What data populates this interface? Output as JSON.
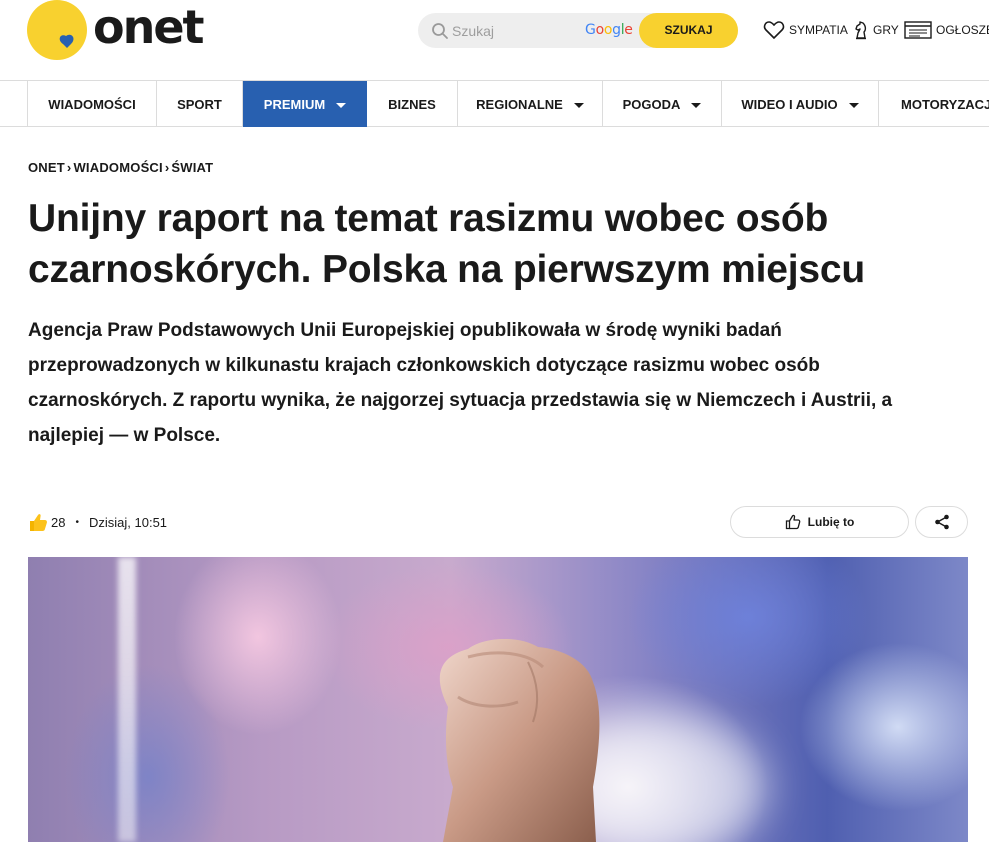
{
  "header": {
    "logo_text": "onet",
    "search": {
      "placeholder": "Szukaj",
      "provider": "Google",
      "button_label": "SZUKAJ"
    },
    "links": [
      {
        "label": "SYMPATIA",
        "icon": "heart-icon"
      },
      {
        "label": "GRY",
        "icon": "chess-knight-icon"
      },
      {
        "label": "OGŁOSZE",
        "icon": "ads-icon"
      }
    ]
  },
  "nav": {
    "items": [
      {
        "label": "WIADOMOŚCI",
        "dropdown": false
      },
      {
        "label": "SPORT",
        "dropdown": false
      },
      {
        "label": "PREMIUM",
        "dropdown": true,
        "active": true
      },
      {
        "label": "BIZNES",
        "dropdown": false
      },
      {
        "label": "REGIONALNE",
        "dropdown": true
      },
      {
        "label": "POGODA",
        "dropdown": true
      },
      {
        "label": "WIDEO I AUDIO",
        "dropdown": true
      },
      {
        "label": "MOTORYZACJA",
        "dropdown": false
      }
    ]
  },
  "article": {
    "breadcrumb": [
      "ONET",
      "WIADOMOŚCI",
      "ŚWIAT"
    ],
    "title": "Unijny raport na temat rasizmu wobec osób czarnoskórych. Polska na pierwszym miejscu",
    "lead": "Agencja Praw Podstawowych Unii Europejskiej opublikowała w środę wyniki badań przeprowadzonych w kilkunastu krajach członkowskich dotyczące rasizmu wobec osób czarnoskórych. Z raportu wynika, że najgorzej sytuacja przedstawia się w Niemczech i Austrii, a najlepiej — w Polsce.",
    "reactions": "28",
    "date": "Dzisiaj, 10:51",
    "like_label": "Lubię to"
  },
  "colors": {
    "brand_yellow": "#f8d12f",
    "nav_active": "#2860b0",
    "text": "#1a1a1a"
  }
}
